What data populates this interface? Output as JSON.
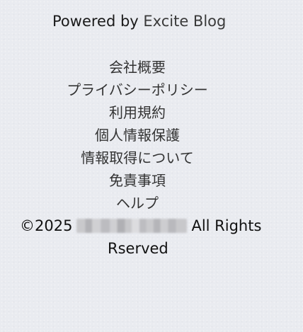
{
  "footer": {
    "powered_prefix": "Powered by ",
    "powered_brand": "Excite Blog",
    "links": [
      "会社概要",
      "プライバシーポリシー",
      "利用規約",
      "個人情報保護",
      "情報取得について",
      "免責事項",
      "ヘルプ"
    ],
    "copyright_prefix": "©2025",
    "copyright_suffix": "All Rights",
    "copyright_line2": "Rserved"
  }
}
